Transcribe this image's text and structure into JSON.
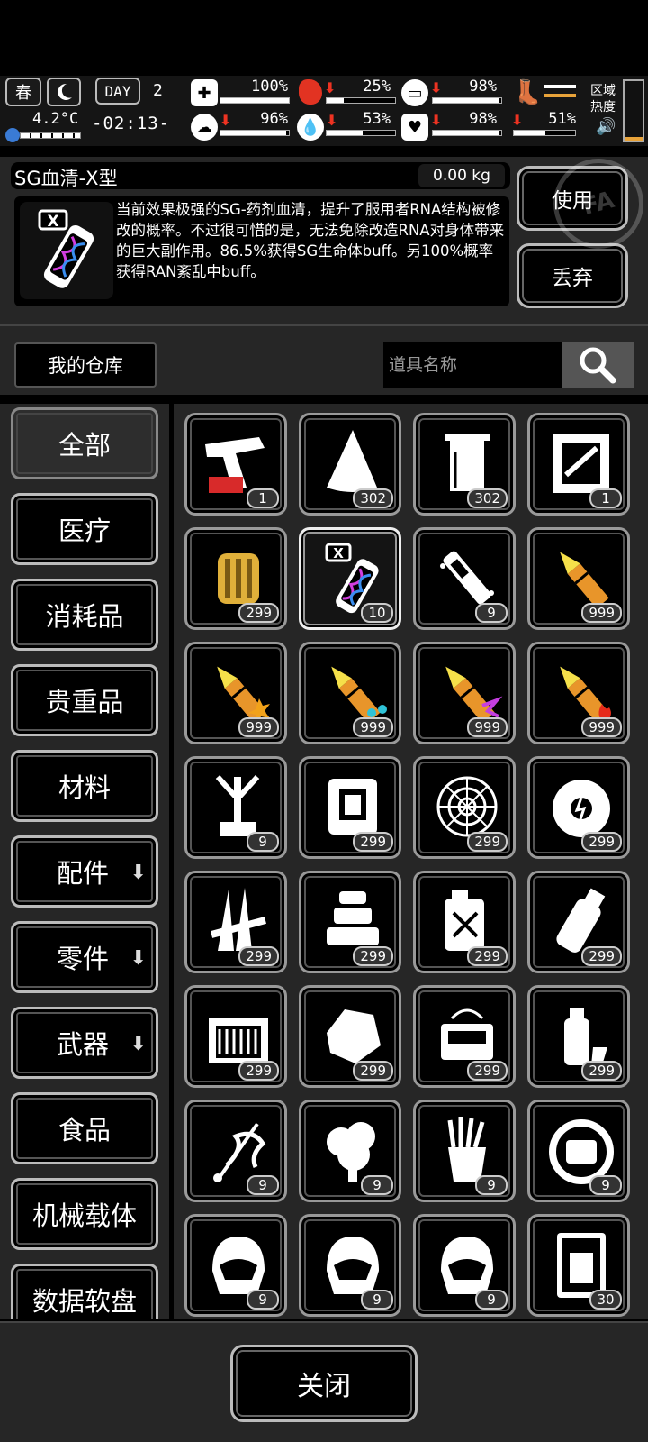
{
  "status": {
    "season": "春",
    "temperature": "4.2°C",
    "day_label": "DAY",
    "day_number": "2",
    "clock": "-02:13-",
    "stats": [
      {
        "icon": "medkit-icon",
        "value": "100%",
        "level": 1.0,
        "down": false
      },
      {
        "icon": "stomach-icon",
        "value": "25%",
        "level": 0.25,
        "down": true
      },
      {
        "icon": "stamina-icon",
        "value": "98%",
        "level": 0.98,
        "down": true
      },
      {
        "icon": "boot-icon",
        "value": "",
        "level": 0.6,
        "down": false
      },
      {
        "icon": "brain-icon",
        "value": "96%",
        "level": 0.96,
        "down": true
      },
      {
        "icon": "water-icon",
        "value": "53%",
        "level": 0.53,
        "down": true
      },
      {
        "icon": "heart-icon",
        "value": "98%",
        "level": 0.98,
        "down": true
      },
      {
        "icon": "sanity-icon",
        "value": "51%",
        "level": 0.51,
        "down": true
      }
    ],
    "zone_heat_label_1": "区域",
    "zone_heat_label_2": "热度",
    "colors": {
      "down_arrow": "#e23322",
      "stomach": "#e23322",
      "cold": "#3a7bd5"
    }
  },
  "item": {
    "name": "SG血清-X型",
    "weight": "0.00 kg",
    "description": "当前效果极强的SG-药剂血清，提升了服用者RNA结构被修改的概率。不过很可惜的是，无法免除改造RNA对身体带来的巨大副作用。86.5%获得SG生命体buff。另100%概率获得RAN紊乱中buff。",
    "use_label": "使用",
    "discard_label": "丢弃",
    "watermark": "FA"
  },
  "warehouse": {
    "title": "我的仓库",
    "search_placeholder": "道具名称"
  },
  "categories": [
    {
      "label": "全部",
      "active": true,
      "arrow": false
    },
    {
      "label": "医疗",
      "active": false,
      "arrow": false
    },
    {
      "label": "消耗品",
      "active": false,
      "arrow": false
    },
    {
      "label": "贵重品",
      "active": false,
      "arrow": false
    },
    {
      "label": "材料",
      "active": false,
      "arrow": false
    },
    {
      "label": "配件",
      "active": false,
      "arrow": true
    },
    {
      "label": "零件",
      "active": false,
      "arrow": true
    },
    {
      "label": "武器",
      "active": false,
      "arrow": true
    },
    {
      "label": "食品",
      "active": false,
      "arrow": false
    },
    {
      "label": "机械载体",
      "active": false,
      "arrow": false
    },
    {
      "label": "数据软盘",
      "active": false,
      "arrow": false
    }
  ],
  "items": [
    {
      "icon": "flare-gun-icon",
      "count": "1"
    },
    {
      "icon": "cloth-icon",
      "count": "302"
    },
    {
      "icon": "towel-icon",
      "count": "302"
    },
    {
      "icon": "weapon-crate-icon",
      "count": "1"
    },
    {
      "icon": "golden-engine-icon",
      "count": "299"
    },
    {
      "icon": "serum-x-icon",
      "count": "10",
      "selected": true
    },
    {
      "icon": "injector-icon",
      "count": "9"
    },
    {
      "icon": "bullet-icon",
      "count": "999"
    },
    {
      "icon": "explosive-bullet-icon",
      "count": "999"
    },
    {
      "icon": "water-bullet-icon",
      "count": "999"
    },
    {
      "icon": "energy-bullet-icon",
      "count": "999"
    },
    {
      "icon": "fire-bullet-icon",
      "count": "999"
    },
    {
      "icon": "robot-arm-icon",
      "count": "9"
    },
    {
      "icon": "armor-plate-icon",
      "count": "299"
    },
    {
      "icon": "spider-web-icon",
      "count": "299"
    },
    {
      "icon": "core-ball-icon",
      "count": "299"
    },
    {
      "icon": "spikes-icon",
      "count": "299"
    },
    {
      "icon": "ingots-icon",
      "count": "299"
    },
    {
      "icon": "fuel-can-icon",
      "count": "299"
    },
    {
      "icon": "bottle-icon",
      "count": "299"
    },
    {
      "icon": "box-icon",
      "count": "299"
    },
    {
      "icon": "stone-icon",
      "count": "299"
    },
    {
      "icon": "machine-icon",
      "count": "299"
    },
    {
      "icon": "spray-can-icon",
      "count": "299"
    },
    {
      "icon": "dragon-icon",
      "count": "9"
    },
    {
      "icon": "cauliflower-icon",
      "count": "9"
    },
    {
      "icon": "fries-icon",
      "count": "9"
    },
    {
      "icon": "ring-device-icon",
      "count": "9"
    },
    {
      "icon": "helmet-icon",
      "count": "9"
    },
    {
      "icon": "helmet-icon",
      "count": "9"
    },
    {
      "icon": "helmet-icon",
      "count": "9"
    },
    {
      "icon": "data-card-icon",
      "count": "30"
    }
  ],
  "footer": {
    "close_label": "关闭"
  }
}
